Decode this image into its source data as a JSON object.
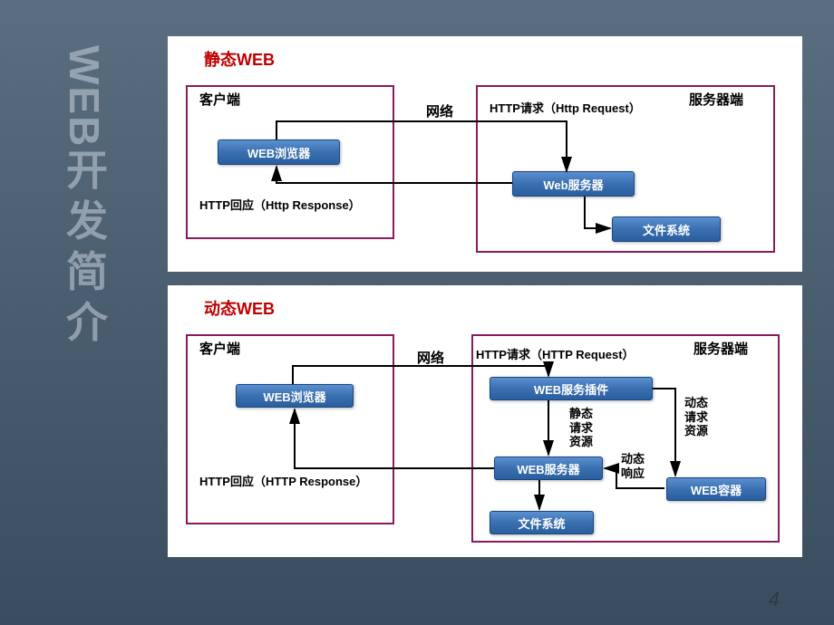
{
  "sidebarTitle": {
    "eng": "WEB",
    "chs": "开发简介"
  },
  "pageNumber": "4",
  "static": {
    "title": "静态WEB",
    "clientLabel": "客户端",
    "serverLabel": "服务器端",
    "networkLabel": "网络",
    "browser": "WEB浏览器",
    "webServer": "Web服务器",
    "fileSystem": "文件系统",
    "httpRequest": "HTTP请求（Http Request）",
    "httpResponse": "HTTP回应（Http Response）"
  },
  "dynamic": {
    "title": "动态WEB",
    "clientLabel": "客户端",
    "serverLabel": "服务器端",
    "networkLabel": "网络",
    "browser": "WEB浏览器",
    "plugin": "WEB服务插件",
    "webServer": "WEB服务器",
    "fileSystem": "文件系统",
    "container": "WEB容器",
    "httpRequest": "HTTP请求（HTTP Request）",
    "httpResponse": "HTTP回应（HTTP Response）",
    "staticReq": "静态\n请求\n资源",
    "dynReq": "动态\n请求\n资源",
    "dynResp": "动态\n响应"
  }
}
